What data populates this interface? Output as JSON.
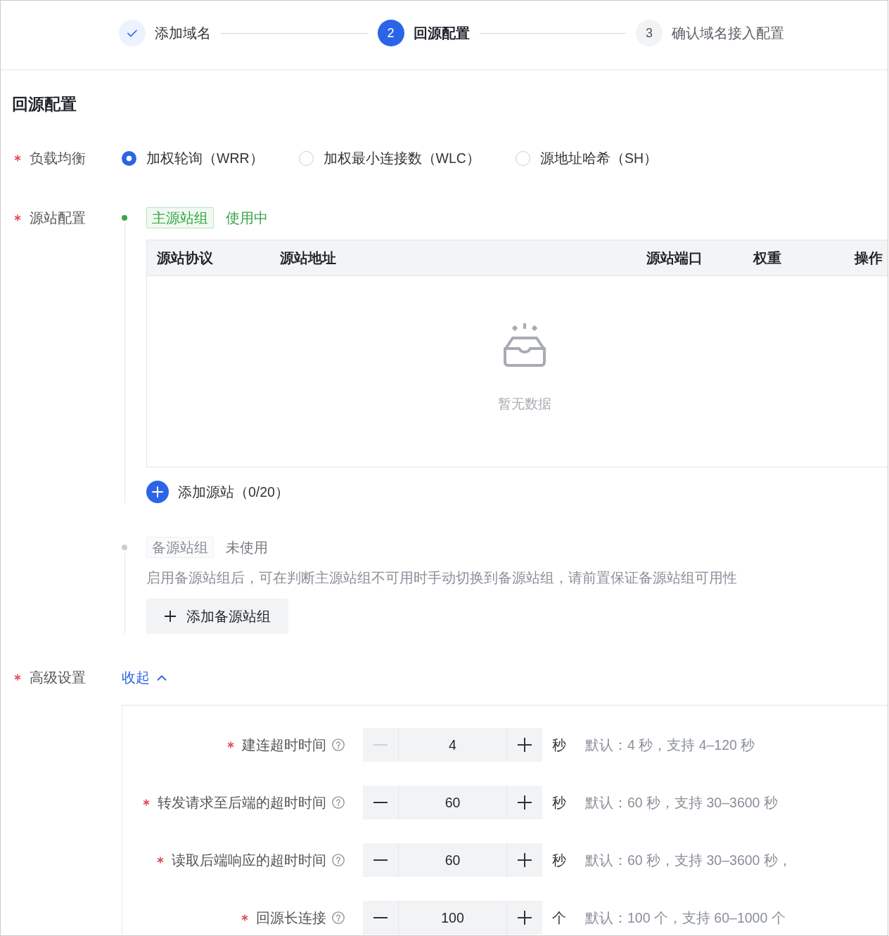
{
  "steps": [
    {
      "label": "添加域名",
      "completed": true,
      "selected": false
    },
    {
      "number": "2",
      "label": "回源配置",
      "completed": false,
      "selected": true
    },
    {
      "number": "3",
      "label": "确认域名接入配置",
      "completed": false,
      "selected": false
    }
  ],
  "section_title": "回源配置",
  "load_balancing": {
    "label": "负载均衡",
    "required": true,
    "options": [
      {
        "label": "加权轮询（WRR）",
        "selected": true
      },
      {
        "label": "加权最小连接数（WLC）",
        "selected": false
      },
      {
        "label": "源地址哈希（SH）",
        "selected": false
      }
    ]
  },
  "origin_config": {
    "label": "源站配置",
    "required": true,
    "primary_group": {
      "tag": "主源站组",
      "status": "使用中",
      "active": true,
      "table": {
        "columns": [
          "源站协议",
          "源站地址",
          "源站端口",
          "权重",
          "操作"
        ],
        "empty_text": "暂无数据"
      },
      "add_link": "添加源站（0/20）"
    },
    "backup_group": {
      "tag": "备源站组",
      "status": "未使用",
      "active": false,
      "description": "启用备源站组后，可在判断主源站组不可用时手动切换到备源站组，请前置保证备源站组可用性",
      "add_button": "添加备源站组"
    }
  },
  "advanced": {
    "label": "高级设置",
    "required": true,
    "toggle": "收起",
    "expanded": true,
    "fields": [
      {
        "label": "建连超时时间",
        "required": true,
        "value": "4",
        "unit": "秒",
        "hint": "默认：4 秒，支持 4–120 秒",
        "decrement_disabled": true
      },
      {
        "label": "转发请求至后端的超时时间",
        "required": true,
        "value": "60",
        "unit": "秒",
        "hint": "默认：60 秒，支持 30–3600 秒",
        "decrement_disabled": false
      },
      {
        "label": "读取后端响应的超时时间",
        "required": true,
        "value": "60",
        "unit": "秒",
        "hint": "默认：60 秒，支持 30–3600 秒，",
        "decrement_disabled": false
      },
      {
        "label": "回源长连接",
        "required": true,
        "value": "100",
        "unit": "个",
        "hint": "默认：100 个，支持 60–1000 个",
        "decrement_disabled": false
      }
    ]
  }
}
